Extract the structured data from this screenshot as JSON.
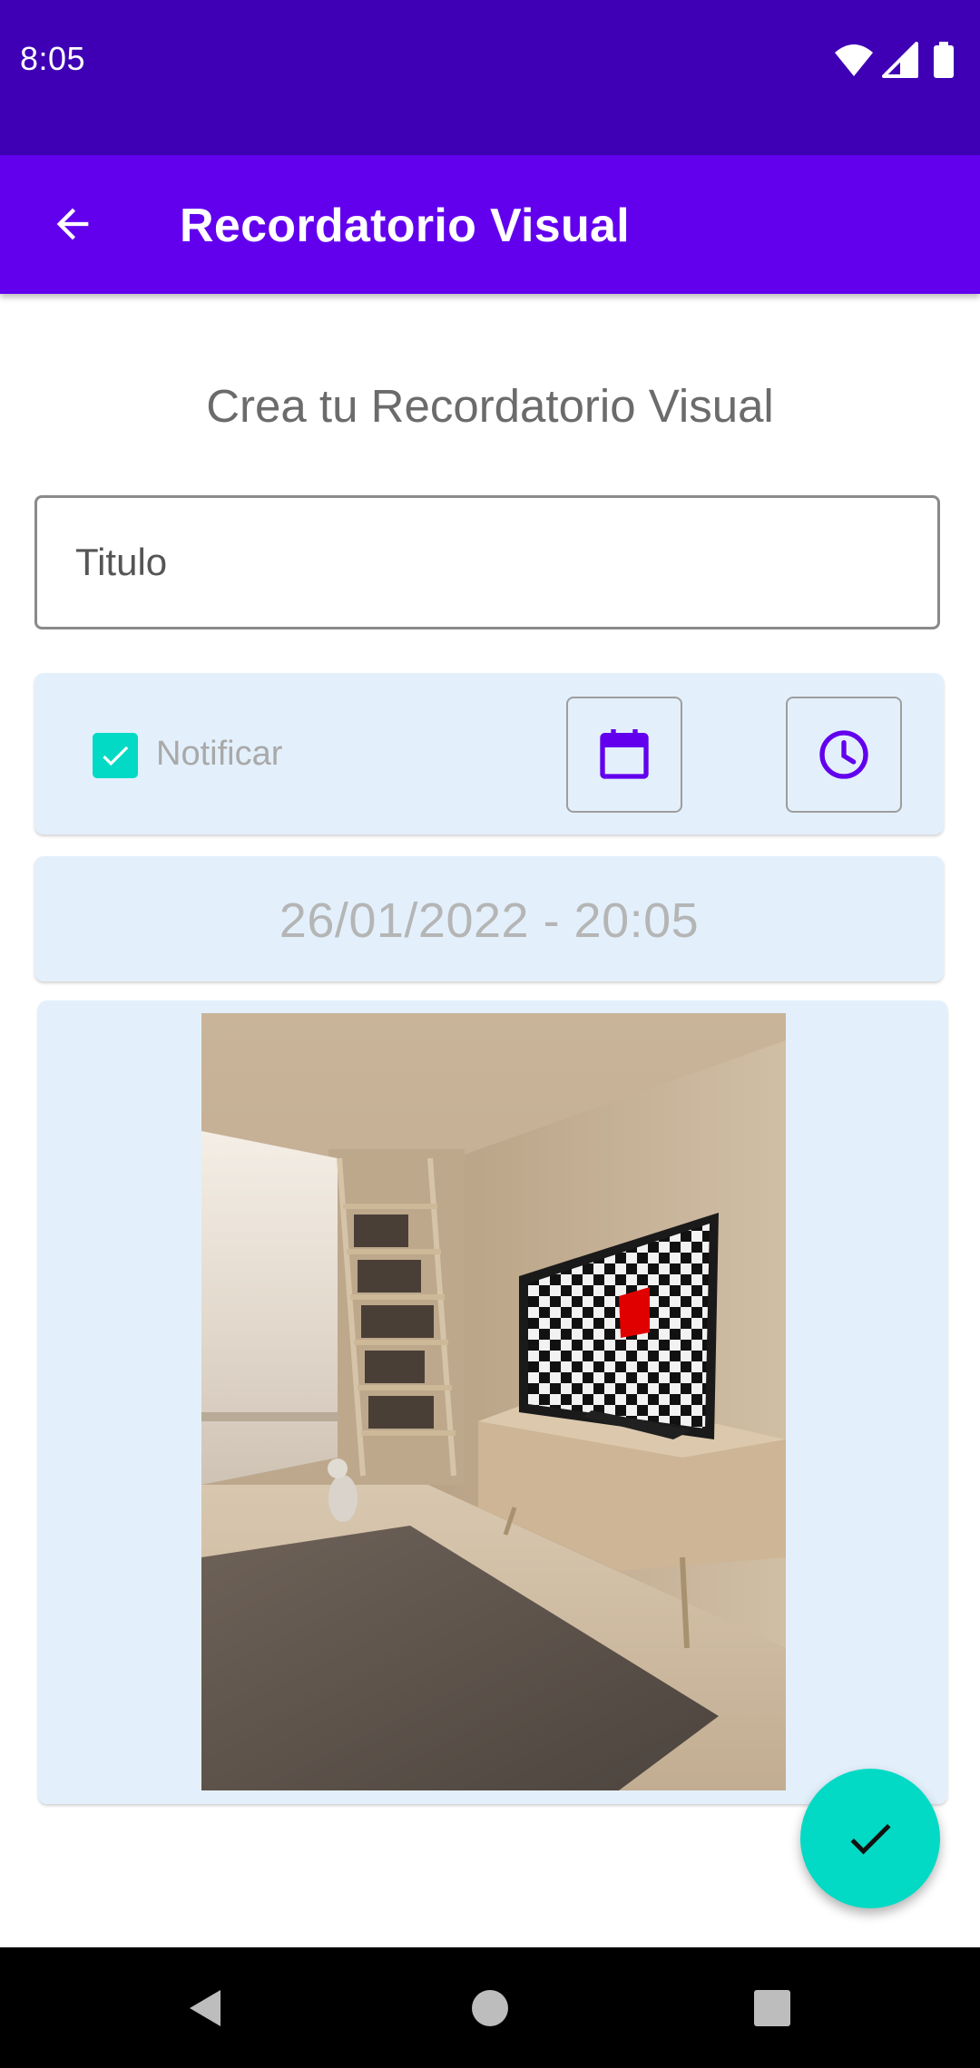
{
  "status_bar": {
    "time": "8:05",
    "background": "#3F00B5",
    "icons": [
      "wifi-icon",
      "signal-icon",
      "battery-icon"
    ]
  },
  "app_bar": {
    "title": "Recordatorio Visual",
    "background": "#6200EE",
    "back_icon": "arrow-back-icon"
  },
  "form": {
    "heading": "Crea tu Recordatorio Visual",
    "title_field": {
      "value": "",
      "placeholder": "Titulo"
    },
    "notify": {
      "label": "Notificar",
      "checked": true,
      "date_icon": "calendar-icon",
      "time_icon": "clock-icon"
    },
    "datetime": "26/01/2022 - 20:05",
    "image": "room-photo"
  },
  "fab": {
    "icon": "check-icon",
    "color": "#03DAC5"
  },
  "nav_bar": {
    "buttons": [
      "back-triangle-icon",
      "home-circle-icon",
      "recents-square-icon"
    ]
  },
  "colors": {
    "accent": "#03DAC5",
    "primary": "#6200EE",
    "primary_dark": "#3F00B5",
    "card_background": "#E3F0FC"
  }
}
